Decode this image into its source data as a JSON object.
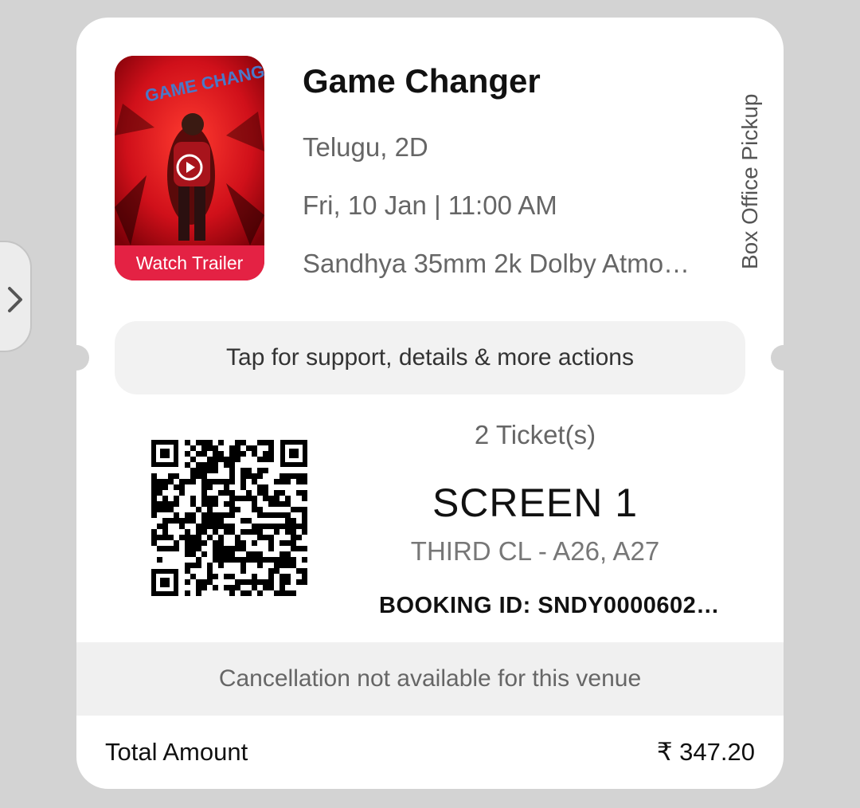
{
  "movie": {
    "title": "Game Changer",
    "language_format": "Telugu, 2D",
    "showtime": "Fri, 10 Jan | 11:00 AM",
    "venue": "Sandhya 35mm 2k Dolby Atmo…",
    "pickup": "Box Office Pickup",
    "poster_art_text": "GAME CHANGER",
    "trailer_label": "Watch Trailer"
  },
  "support": {
    "label": "Tap for support, details & more actions"
  },
  "tickets": {
    "count": "2 Ticket(s)",
    "screen": "SCREEN 1",
    "seats": "THIRD CL - A26, A27",
    "booking_id": "BOOKING ID: SNDY0000602…"
  },
  "cancellation": {
    "label": "Cancellation not available for this venue"
  },
  "total": {
    "label": "Total Amount",
    "value": "₹ 347.20"
  },
  "icons": {
    "side_tab": "chevron-right-icon",
    "play": "play-icon"
  },
  "colors": {
    "background": "#d3d3d3",
    "card": "#ffffff",
    "accent": "#e42244"
  }
}
